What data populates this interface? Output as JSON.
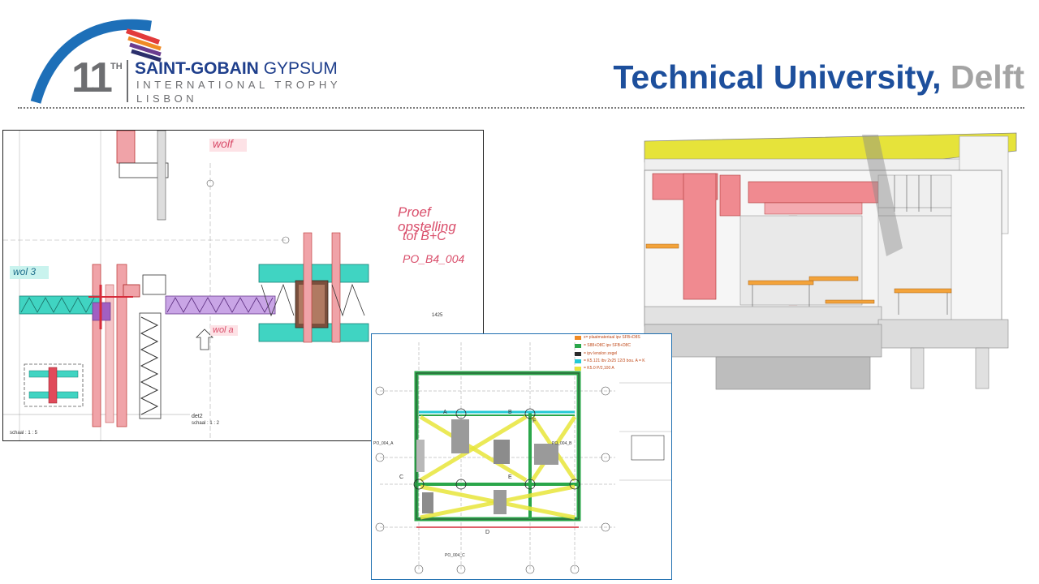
{
  "logo": {
    "number": "11",
    "superscript": "TH",
    "brand_bold": "SAINT-GOBAIN",
    "brand_regular": "GYPSUM",
    "line2": "INTERNATIONAL TROPHY",
    "line3": "LISBON",
    "arc_colors": [
      "#1d6fb8",
      "#e23b3b",
      "#f08a24",
      "#6b3d8f",
      "#2b2f6c"
    ]
  },
  "title": {
    "main": "Technical University,",
    "city": "Delft",
    "main_color": "#1d4f9c",
    "city_color": "#a4a4a4"
  },
  "detail_drawing": {
    "handwritten_notes": [
      "wolf",
      "Proef opstelling",
      "tof B+C",
      "PO_B4_004",
      "wol 3",
      "wol a"
    ],
    "labels": {
      "det": "det2",
      "scale_left": "schaal : 1 : 5",
      "scale_right": "schaal : 1 : 2",
      "sheet_number": "1425"
    }
  },
  "floor_plan": {
    "legend": [
      {
        "color": "#f08a24",
        "text": "x= plaatmateriaal ipv SFB+D8S"
      },
      {
        "color": "#2aa64a",
        "text": "= S88+D8C ipv SFB+D8C"
      },
      {
        "color": "#2b2b2b",
        "text": "= ipv lenslon zegel"
      },
      {
        "color": "#23c9d6",
        "text": "= K5.121 ibv 2x25 12/3 bou. A = K"
      },
      {
        "color": "#e8e63a",
        "text": "= K5.0 P/2,100 A"
      }
    ],
    "grid_labels": [
      "A",
      "B",
      "C",
      "D",
      "E",
      "F"
    ],
    "section_tags": [
      "PO_004_A",
      "PO_004_B",
      "PO_004_C"
    ]
  }
}
